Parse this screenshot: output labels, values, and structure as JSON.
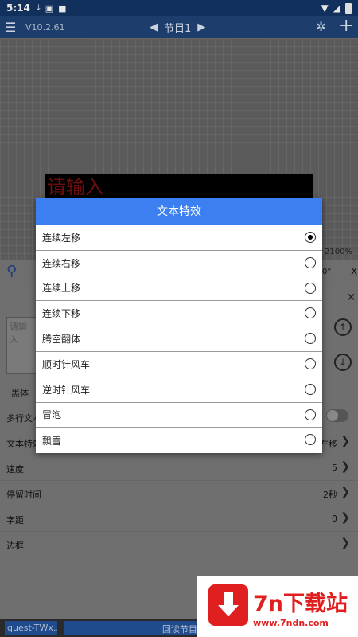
{
  "status_bar": {
    "time": "5:14"
  },
  "app_bar": {
    "version": "V10.2.61",
    "program": "节目1"
  },
  "canvas": {
    "led_text": "请输入",
    "zoom": "2100%"
  },
  "tool_row": {
    "degree": "0°",
    "close": "X"
  },
  "panel": {
    "input_placeholder": "请输入",
    "font": "黑体",
    "multiline_label": "多行文本",
    "effect_label": "文本特效",
    "effect_value": "左移",
    "rows": [
      {
        "label": "速度",
        "value": "5"
      },
      {
        "label": "停留时间",
        "value": "2秒"
      },
      {
        "label": "字距",
        "value": "0"
      },
      {
        "label": "边框",
        "value": ""
      }
    ]
  },
  "bottom_bar": {
    "left": "quest-TWx...",
    "right": "回读节目"
  },
  "dialog": {
    "title": "文本特效",
    "selected_index": 0,
    "options": [
      "连续左移",
      "连续右移",
      "连续上移",
      "连续下移",
      "腾空翻体",
      "顺时针风车",
      "逆时针风车",
      "冒泡",
      "飘雪"
    ]
  },
  "watermark": {
    "title": "7n下载站",
    "url": "www.7ndn.com"
  },
  "colors": {
    "accent": "#3b7ff0",
    "app_bar": "#1d3e6d",
    "watermark": "#e02020"
  }
}
